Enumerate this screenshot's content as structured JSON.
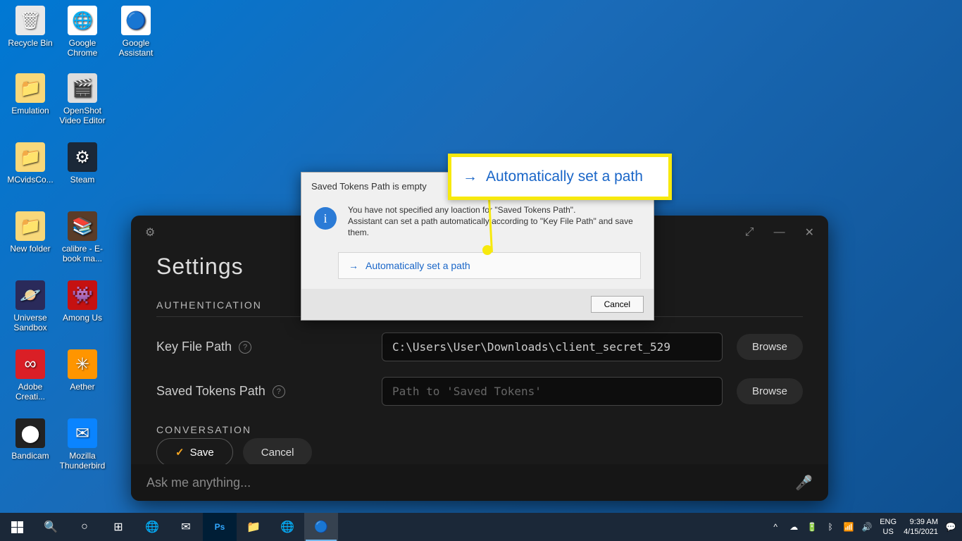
{
  "desktop": {
    "icons": [
      {
        "label": "Recycle Bin",
        "bg": "#e8e8e8",
        "glyph": "🗑"
      },
      {
        "label": "Google Chrome",
        "bg": "#fff",
        "glyph": "🌐"
      },
      {
        "label": "Google Assistant",
        "bg": "#fff",
        "glyph": "🔵"
      },
      {
        "label": "Emulation",
        "bg": "#f8d87a",
        "glyph": "📁"
      },
      {
        "label": "OpenShot Video Editor",
        "bg": "#ddd",
        "glyph": "🎬"
      },
      {
        "label": "MCvidsCo...",
        "bg": "#f8d87a",
        "glyph": "📁"
      },
      {
        "label": "Steam",
        "bg": "#1b2838",
        "glyph": "⚙"
      },
      {
        "label": "New folder",
        "bg": "#f8d87a",
        "glyph": "📁"
      },
      {
        "label": "calibre - E-book ma...",
        "bg": "#5a3c28",
        "glyph": "📚"
      },
      {
        "label": "Universe Sandbox",
        "bg": "#2a2a5a",
        "glyph": "🪐"
      },
      {
        "label": "Among Us",
        "bg": "#c51111",
        "glyph": "👾"
      },
      {
        "label": "Adobe Creati...",
        "bg": "#da1f26",
        "glyph": "∞"
      },
      {
        "label": "Aether",
        "bg": "#ff9500",
        "glyph": "✳"
      },
      {
        "label": "Bandicam",
        "bg": "#222",
        "glyph": "⬤"
      },
      {
        "label": "Mozilla Thunderbird",
        "bg": "#0a84ff",
        "glyph": "✉"
      }
    ]
  },
  "assistant": {
    "title": "Settings",
    "section_auth": "AUTHENTICATION",
    "section_conv": "CONVERSATION",
    "key_file_label": "Key File Path",
    "key_file_value": "C:\\Users\\User\\Downloads\\client_secret_529",
    "tokens_label": "Saved Tokens Path",
    "tokens_placeholder": "Path to 'Saved Tokens'",
    "browse": "Browse",
    "save": "Save",
    "cancel": "Cancel",
    "ask_placeholder": "Ask me anything..."
  },
  "modal": {
    "title": "Saved Tokens Path is empty",
    "line1": "You have not specified any loaction for \"Saved Tokens Path\".",
    "line2": "Assistant can set a path automatically according to \"Key File Path\" and save them.",
    "link": "Automatically set a path",
    "cancel": "Cancel"
  },
  "callout": {
    "text": "Automatically set a path"
  },
  "taskbar": {
    "lang1": "ENG",
    "lang2": "US",
    "time": "9:39 AM",
    "date": "4/15/2021"
  }
}
